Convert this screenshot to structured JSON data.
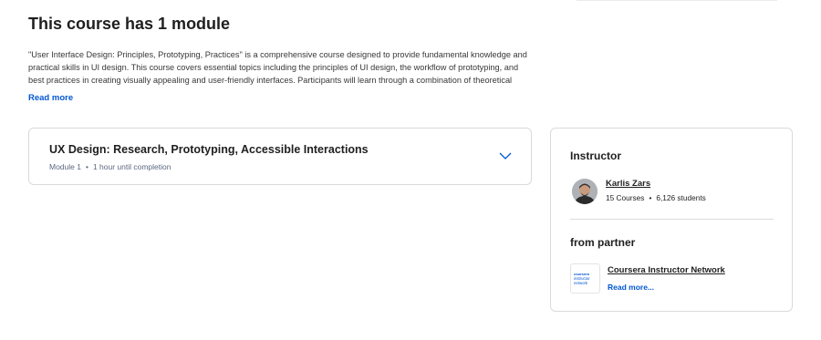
{
  "section": {
    "title": "This course has 1 module",
    "description": "\"User Interface Design: Principles, Prototyping, Practices\" is a comprehensive course designed to provide fundamental knowledge and practical skills in UI design. This course covers essential topics including the principles of UI design, the workflow of prototyping, and best practices in creating visually appealing and user-friendly interfaces. Participants will learn through a combination of theoretical",
    "read_more": "Read more"
  },
  "module": {
    "title": "UX Design: Research, Prototyping, Accessible Interactions",
    "label": "Module 1",
    "separator": "•",
    "duration": "1 hour until completion",
    "expand_icon": "chevron-down-icon"
  },
  "instructor": {
    "heading": "Instructor",
    "name": "Karlis Zars",
    "courses": "15 Courses",
    "separator": "•",
    "students": "6,126 students"
  },
  "partner": {
    "heading": "from partner",
    "logo_line1": "coursera",
    "logo_line2": "instructor network",
    "name": "Coursera Instructor Network",
    "read_more": "Read more..."
  },
  "colors": {
    "link": "#0056d2",
    "text": "#1f1f1f",
    "border": "#dadada"
  }
}
